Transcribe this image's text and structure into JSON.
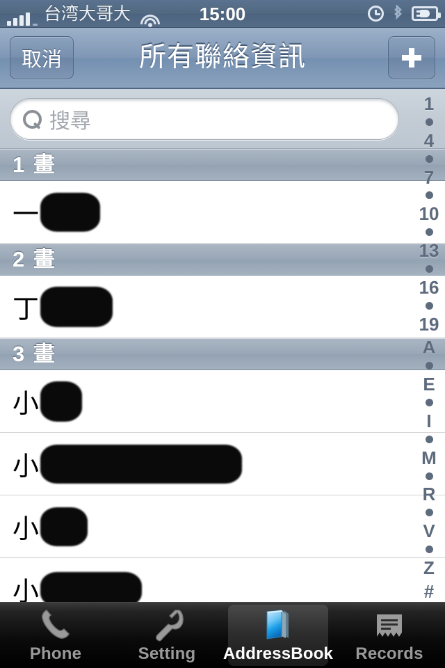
{
  "status_bar": {
    "carrier": "台湾大哥大",
    "time": "15:00",
    "icons": [
      "signal-bars",
      "wifi-icon",
      "alarm-clock-icon",
      "bluetooth-icon",
      "battery-charging-icon"
    ],
    "signal_bars": 4
  },
  "nav_bar": {
    "cancel_label": "取消",
    "title": "所有聯絡資訊",
    "add_label": "+"
  },
  "search": {
    "placeholder": "搜尋",
    "value": ""
  },
  "sections": [
    {
      "header": "1 畫",
      "rows": [
        {
          "prefix": "一",
          "redact_width": 86,
          "redact_height": 56
        }
      ]
    },
    {
      "header": "2 畫",
      "rows": [
        {
          "prefix": "丁",
          "redact_width": 104,
          "redact_height": 58
        }
      ]
    },
    {
      "header": "3 畫",
      "rows": [
        {
          "prefix": "小",
          "redact_width": 60,
          "redact_height": 58
        },
        {
          "prefix": "小",
          "redact_width": 290,
          "redact_height": 56
        },
        {
          "prefix": "小",
          "redact_width": 68,
          "redact_height": 56
        },
        {
          "prefix": "小",
          "redact_width": 146,
          "redact_height": 50
        }
      ]
    }
  ],
  "index_bar": [
    "1",
    "•",
    "4",
    "•",
    "7",
    "•",
    "10",
    "•",
    "13",
    "•",
    "16",
    "•",
    "19",
    "A",
    "•",
    "E",
    "•",
    "I",
    "•",
    "M",
    "•",
    "R",
    "•",
    "V",
    "•",
    "Z",
    "#"
  ],
  "tab_bar": {
    "tabs": [
      {
        "label": "Phone",
        "icon": "phone-handset-icon",
        "active": false
      },
      {
        "label": "Setting",
        "icon": "wrench-icon",
        "active": false
      },
      {
        "label": "AddressBook",
        "icon": "address-book-icon",
        "active": true
      },
      {
        "label": "Records",
        "icon": "records-receipt-icon",
        "active": false
      }
    ]
  },
  "colors": {
    "status_bar": "#526981",
    "nav_bar": "#7f97b5",
    "section_header": "#98a6b6",
    "tab_bar": "#000000",
    "accent_blue": "#3aa8e8",
    "index_text": "#5d6b7d"
  }
}
